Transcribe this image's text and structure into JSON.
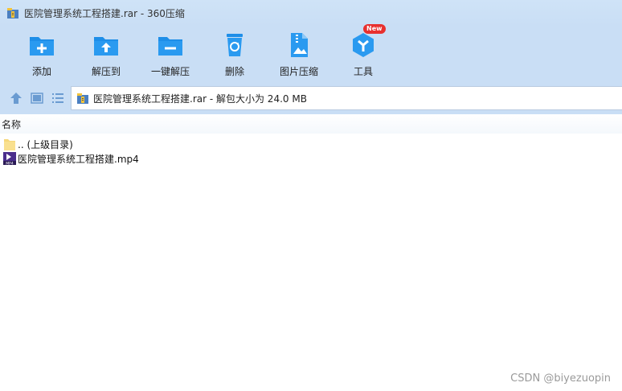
{
  "window": {
    "title": "医院管理系统工程搭建.rar - 360压缩"
  },
  "toolbar": {
    "items": [
      {
        "label": "添加",
        "icon": "folder-plus-icon"
      },
      {
        "label": "解压到",
        "icon": "folder-extract-icon"
      },
      {
        "label": "一键解压",
        "icon": "folder-minus-icon"
      },
      {
        "label": "删除",
        "icon": "recycle-bin-icon"
      },
      {
        "label": "图片压缩",
        "icon": "image-zip-icon"
      },
      {
        "label": "工具",
        "icon": "tools-cube-icon",
        "badge": "New"
      }
    ]
  },
  "nav": {
    "path": "医院管理系统工程搭建.rar - 解包大小为 24.0 MB"
  },
  "filelist": {
    "header_name": "名称",
    "rows": [
      {
        "name": ".. (上级目录)",
        "icon": "folder-icon"
      },
      {
        "name": "医院管理系统工程搭建.mp4",
        "icon": "mp4-file-icon"
      }
    ]
  },
  "watermark": "CSDN @biyezuopin",
  "colors": {
    "toolbar_bg": "#c9def5",
    "icon_blue": "#1e8ee8",
    "badge_red": "#e8302e"
  }
}
